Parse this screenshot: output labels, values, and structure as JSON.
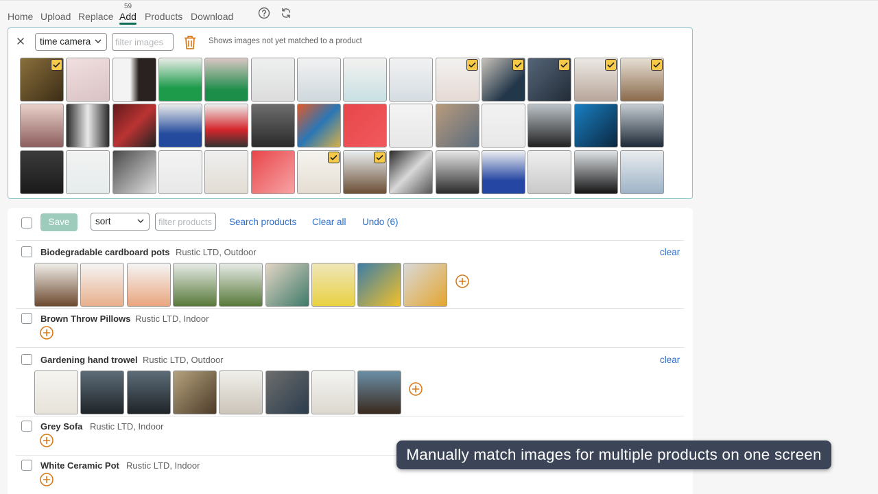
{
  "nav": {
    "items": [
      "Home",
      "Upload",
      "Replace",
      "Add",
      "Products",
      "Download"
    ],
    "active": "Add",
    "badge": "59"
  },
  "image_panel": {
    "tag_select": "time camera",
    "filter_placeholder": "filter images",
    "hint": "Shows images not yet matched to a product"
  },
  "toolbar": {
    "save_label": "Save",
    "sort_label": "sort",
    "filter_placeholder": "filter products",
    "search_label": "Search products",
    "clear_all_label": "Clear all",
    "undo_label": "Undo (6)"
  },
  "products": [
    {
      "name": "Biodegradable cardboard pots",
      "meta": "Rustic LTD, Outdoor",
      "clear": "clear"
    },
    {
      "name": "Brown Throw Pillows",
      "meta": "Rustic LTD, Indoor",
      "clear": ""
    },
    {
      "name": "Gardening hand trowel",
      "meta": "Rustic LTD, Outdoor",
      "clear": "clear"
    },
    {
      "name": "Grey Sofa",
      "meta": "Rustic LTD, Indoor",
      "clear": ""
    },
    {
      "name": "White Ceramic Pot",
      "meta": "Rustic LTD, Indoor",
      "clear": ""
    }
  ],
  "caption": "Manually match images for multiple products on one screen",
  "colors": {
    "accent": "#0e6e55",
    "link": "#2c6ecb",
    "check": "#f7c948",
    "plus": "#d97a1c",
    "panel_border": "#8ec3cf"
  }
}
